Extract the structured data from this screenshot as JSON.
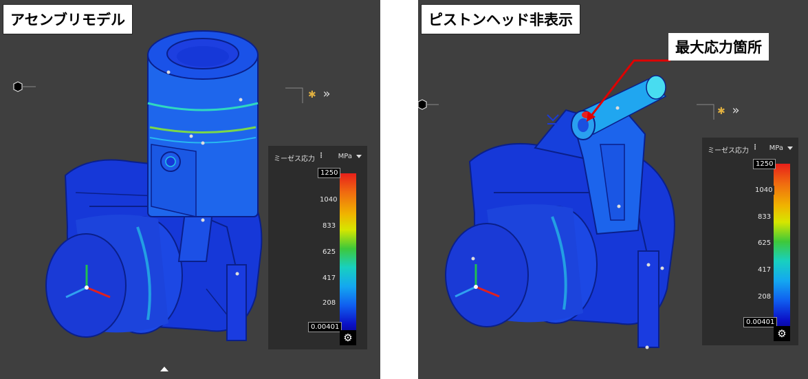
{
  "left_panel": {
    "title": "アセンブリモデル",
    "legend": {
      "quantity": "ミーゼス応力",
      "menu_icon": "vertical-dots",
      "unit": "MPa",
      "ticks": [
        "1250",
        "1040",
        "833",
        "625",
        "417",
        "208",
        "0.00401"
      ],
      "settings_icon": "gear-icon"
    }
  },
  "right_panel": {
    "title": "ピストンヘッド非表示",
    "callout": "最大応力箇所",
    "legend": {
      "quantity": "ミーゼス応力",
      "menu_icon": "vertical-dots",
      "unit": "MPa",
      "ticks": [
        "1250",
        "1040",
        "833",
        "625",
        "417",
        "208",
        "0.00401"
      ],
      "settings_icon": "gear-icon"
    }
  },
  "colors": {
    "viewport_bg": "#3f3f3f",
    "legend_bg": "#2c2c2c",
    "stress_low": "#0b12c8",
    "stress_high": "#e8201a",
    "callout_line": "#e00000"
  },
  "icons": {
    "nav_cube": "hexagon-icon",
    "expand": "double-chevron-right-icon",
    "view_toggle": "sparkle-icon",
    "axis_triad": "xyz-triad-icon",
    "collapse_toggle": "chevron-up-icon"
  }
}
